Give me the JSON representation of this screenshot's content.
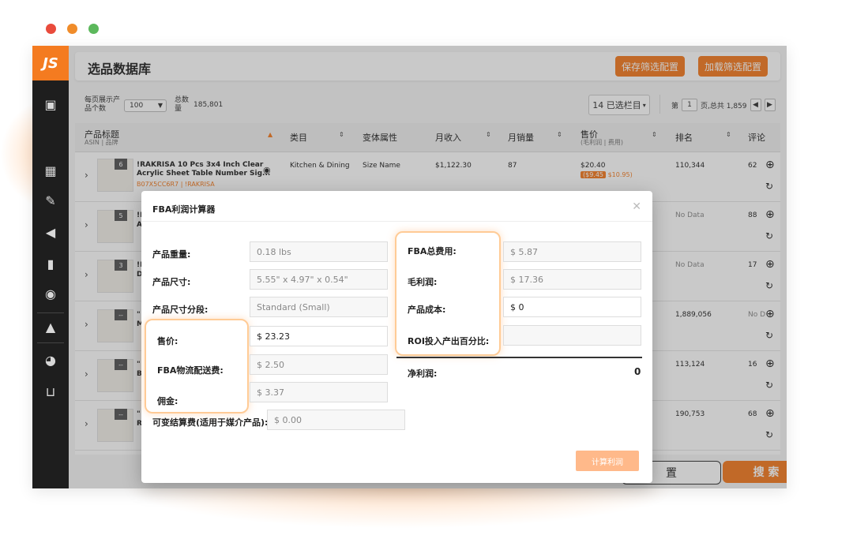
{
  "window": {
    "dots": [
      "#e94b3c",
      "#f08c2a",
      "#5cb85c"
    ]
  },
  "sidebar": {
    "logo": "JS"
  },
  "header": {
    "title": "选品数据库",
    "save_filter": "保存筛选配置",
    "load_filter": "加载筛选配置"
  },
  "toolbar": {
    "per_page_label": "每页展示产品个数",
    "per_page_value": "100",
    "total_label": "总数量",
    "total_value": "185,801",
    "columns_selected": "14 已选栏目",
    "page_prefix": "第",
    "page_current": "1",
    "page_suffix": "页,总共 1,859"
  },
  "table": {
    "headers": {
      "title": "产品标题",
      "title_sub": "ASIN | 品牌",
      "category": "类目",
      "variant": "变体属性",
      "revenue": "月收入",
      "sales": "月销量",
      "price": "售价",
      "price_sub": "(毛利润 | 费用)",
      "rank": "排名",
      "reviews": "评论"
    },
    "rows": [
      {
        "badge": "6",
        "title_line1": "!RAKRISA 10 Pcs 3x4 Inch Clear",
        "title_line2": "Acrylic Sheet Table Number Sig...",
        "asin": "B07X5CC6R7 | !RAKRISA",
        "category": "Kitchen & Dining",
        "variant": "Size Name",
        "revenue": "$1,122.30",
        "sales": "87",
        "price": "$20.40",
        "profit": "($9.45",
        "fees": "$10.95)",
        "rank": "110,344",
        "reviews": "62"
      },
      {
        "badge": "5",
        "title_line1": "!F",
        "title_line2": "A",
        "rank": "No Data",
        "reviews": "88"
      },
      {
        "badge": "3",
        "title_line1": "!F",
        "title_line2": "D",
        "rank": "No Data",
        "reviews": "17"
      },
      {
        "badge": "--",
        "title_line1": "\"",
        "title_line2": "M",
        "rank": "1,889,056",
        "reviews": "No D"
      },
      {
        "badge": "--",
        "title_line1": "\"",
        "title_line2": "B",
        "rank": "113,124",
        "reviews": "16"
      },
      {
        "badge": "--",
        "title_line1": "\"",
        "title_line2": "R",
        "rank": "190,753",
        "reviews": "68"
      }
    ]
  },
  "bottom": {
    "reset_partial": "置",
    "search": "搜 索"
  },
  "modal": {
    "title": "FBA利润计算器",
    "left": [
      {
        "label": "产品重量:",
        "value": "0.18 lbs"
      },
      {
        "label": "产品尺寸:",
        "value": "5.55\" x 4.97\" x 0.54\""
      },
      {
        "label": "产品尺寸分段:",
        "value": "Standard (Small)"
      },
      {
        "label": "售价:",
        "value": "$ 23.23"
      },
      {
        "label": "FBA物流配送费:",
        "value": "$ 2.50"
      },
      {
        "label": "佣金:",
        "value": "$ 3.37"
      },
      {
        "label": "可变结算费(适用于媒介产品):",
        "value": "$ 0.00"
      }
    ],
    "right": [
      {
        "label": "FBA总费用:",
        "value": "$ 5.87"
      },
      {
        "label": "毛利润:",
        "value": "$ 17.36"
      },
      {
        "label": "产品成本:",
        "value": "$ 0"
      },
      {
        "label": "ROI投入产出百分比:",
        "value": ""
      }
    ],
    "net_profit_label": "净利润:",
    "net_profit_value": "0",
    "calc_button": "计算利润"
  }
}
